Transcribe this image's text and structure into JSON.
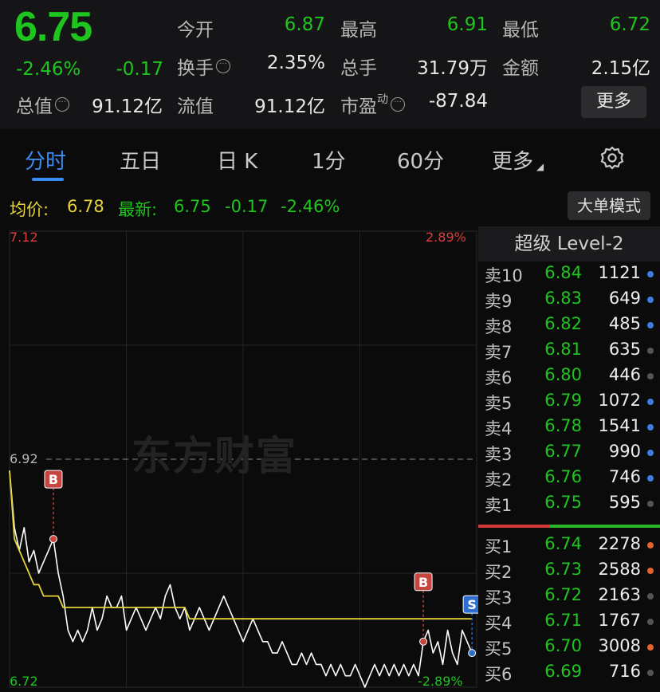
{
  "quote": {
    "price": "6.75",
    "change_pct": "-2.46%",
    "change_val": "-0.17",
    "stats": {
      "open_label": "今开",
      "open_value": "6.87",
      "high_label": "最高",
      "high_value": "6.91",
      "low_label": "最低",
      "low_value": "6.72",
      "turnover_rate_label": "换手",
      "turnover_rate_value": "2.35%",
      "volume_label": "总手",
      "volume_value": "31.79万",
      "amount_label": "金额",
      "amount_value": "2.15亿",
      "market_cap_label": "总值",
      "market_cap_value": "91.12亿",
      "float_cap_label": "流值",
      "float_cap_value": "91.12亿",
      "pe_label": "市盈",
      "pe_sup": "动",
      "pe_value": "-87.84"
    },
    "more_button": "更多"
  },
  "tabs": [
    {
      "label": "分时",
      "active": true
    },
    {
      "label": "五日",
      "active": false
    },
    {
      "label": "日 K",
      "active": false
    },
    {
      "label": "1分",
      "active": false
    },
    {
      "label": "60分",
      "active": false
    },
    {
      "label": "更多",
      "active": false
    }
  ],
  "settings_icon": "gear-icon",
  "infobar": {
    "avg_label": "均价:",
    "avg_value": "6.78",
    "latest_label": "最新:",
    "latest_price": "6.75",
    "latest_change": "-0.17",
    "latest_pct": "-2.46%",
    "mode_button": "大单模式"
  },
  "chart": {
    "y_top": "7.12",
    "y_mid": "6.92",
    "y_bottom": "6.72",
    "pct_top": "2.89%",
    "pct_bottom": "-2.89%",
    "watermark": "东方财富",
    "markers": [
      {
        "letter": "B",
        "color": "#c8443f"
      },
      {
        "letter": "B",
        "color": "#c8443f"
      },
      {
        "letter": "S",
        "color": "#2e6fce"
      }
    ]
  },
  "chart_data": {
    "type": "line",
    "ylim": [
      6.72,
      7.12
    ],
    "prev_close": 6.92,
    "series": [
      {
        "color": "#ffffff",
        "values": [
          6.91,
          6.86,
          6.84,
          6.86,
          6.83,
          6.84,
          6.82,
          6.83,
          6.84,
          6.85,
          6.82,
          6.8,
          6.77,
          6.76,
          6.77,
          6.76,
          6.77,
          6.79,
          6.77,
          6.78,
          6.8,
          6.79,
          6.79,
          6.8,
          6.77,
          6.78,
          6.79,
          6.78,
          6.77,
          6.78,
          6.79,
          6.78,
          6.8,
          6.81,
          6.79,
          6.78,
          6.79,
          6.77,
          6.78,
          6.79,
          6.78,
          6.77,
          6.78,
          6.79,
          6.8,
          6.79,
          6.78,
          6.77,
          6.76,
          6.77,
          6.78,
          6.77,
          6.76,
          6.76,
          6.75,
          6.75,
          6.76,
          6.75,
          6.74,
          6.74,
          6.75,
          6.74,
          6.75,
          6.74,
          6.74,
          6.73,
          6.74,
          6.73,
          6.74,
          6.73,
          6.73,
          6.74,
          6.73,
          6.72,
          6.73,
          6.74,
          6.73,
          6.74,
          6.73,
          6.74,
          6.73,
          6.74,
          6.73,
          6.74,
          6.73,
          6.76,
          6.77,
          6.75,
          6.76,
          6.74,
          6.77,
          6.75,
          6.74,
          6.77,
          6.76,
          6.75
        ]
      },
      {
        "color": "#e6d23a",
        "values": [
          6.91,
          6.85,
          6.84,
          6.83,
          6.82,
          6.81,
          6.81,
          6.8,
          6.8,
          6.8,
          6.8,
          6.79,
          6.79,
          6.79,
          6.79,
          6.79,
          6.79,
          6.79,
          6.79,
          6.79,
          6.79,
          6.79,
          6.79,
          6.79,
          6.79,
          6.79,
          6.79,
          6.79,
          6.79,
          6.79,
          6.79,
          6.79,
          6.79,
          6.79,
          6.79,
          6.79,
          6.79,
          6.78,
          6.78,
          6.78,
          6.78,
          6.78,
          6.78,
          6.78,
          6.78,
          6.78,
          6.78,
          6.78,
          6.78,
          6.78,
          6.78,
          6.78,
          6.78,
          6.78,
          6.78,
          6.78,
          6.78,
          6.78,
          6.78,
          6.78,
          6.78,
          6.78,
          6.78,
          6.78,
          6.78,
          6.78,
          6.78,
          6.78,
          6.78,
          6.78,
          6.78,
          6.78,
          6.78,
          6.78,
          6.78,
          6.78,
          6.78,
          6.78,
          6.78,
          6.78,
          6.78,
          6.78,
          6.78,
          6.78,
          6.78,
          6.78,
          6.78,
          6.78,
          6.78,
          6.78,
          6.78,
          6.78,
          6.78,
          6.78,
          6.78,
          6.78
        ]
      }
    ]
  },
  "book": {
    "title": "超级 Level-2",
    "asks": [
      {
        "label": "卖10",
        "price": "6.84",
        "vol": "1121",
        "dot": "#3b7fe0"
      },
      {
        "label": "卖9",
        "price": "6.83",
        "vol": "649",
        "dot": "#3b7fe0"
      },
      {
        "label": "卖8",
        "price": "6.82",
        "vol": "485",
        "dot": "#3b7fe0"
      },
      {
        "label": "卖7",
        "price": "6.81",
        "vol": "635",
        "dot": "#555555"
      },
      {
        "label": "卖6",
        "price": "6.80",
        "vol": "446",
        "dot": "#555555"
      },
      {
        "label": "卖5",
        "price": "6.79",
        "vol": "1072",
        "dot": "#3b7fe0"
      },
      {
        "label": "卖4",
        "price": "6.78",
        "vol": "1541",
        "dot": "#3b7fe0"
      },
      {
        "label": "卖3",
        "price": "6.77",
        "vol": "990",
        "dot": "#3b7fe0"
      },
      {
        "label": "卖2",
        "price": "6.76",
        "vol": "746",
        "dot": "#3b7fe0"
      },
      {
        "label": "卖1",
        "price": "6.75",
        "vol": "595",
        "dot": "#555555"
      }
    ],
    "bids": [
      {
        "label": "买1",
        "price": "6.74",
        "vol": "2278",
        "dot": "#e4632a"
      },
      {
        "label": "买2",
        "price": "6.73",
        "vol": "2588",
        "dot": "#e4632a"
      },
      {
        "label": "买3",
        "price": "6.72",
        "vol": "2163",
        "dot": "#555555"
      },
      {
        "label": "买4",
        "price": "6.71",
        "vol": "1767",
        "dot": "#555555"
      },
      {
        "label": "买5",
        "price": "6.70",
        "vol": "3008",
        "dot": "#e4632a"
      },
      {
        "label": "买6",
        "price": "6.69",
        "vol": "716",
        "dot": "#555555"
      }
    ]
  }
}
